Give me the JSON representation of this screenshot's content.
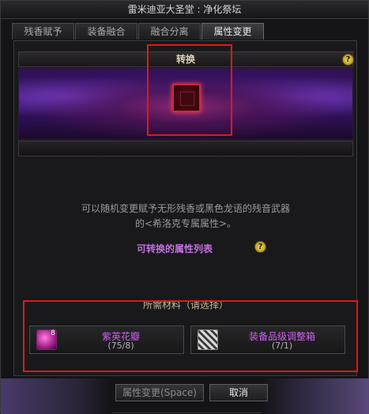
{
  "window": {
    "title": "雷米迪亚大圣堂 : 净化祭坛"
  },
  "tabs": [
    {
      "label": "残香赋予"
    },
    {
      "label": "装备融合"
    },
    {
      "label": "融合分离"
    },
    {
      "label": "属性变更",
      "active": true
    }
  ],
  "section": {
    "title": "转换",
    "help": "?"
  },
  "description": {
    "line1": "可以随机变更赋予无形残香或黑色龙语的残音武器",
    "line2": "的<希洛克专属属性>。"
  },
  "attribute_list": {
    "title": "可转换的属性列表",
    "help": "?"
  },
  "materials": {
    "header": "所需材料（请选择）",
    "items": [
      {
        "name": "紫英花瓣",
        "count": "(75/8)",
        "icon": "purple-petal-icon",
        "badge": "8"
      },
      {
        "name": "装备品级调整箱",
        "count": "(7/1)",
        "icon": "equipment-grade-box-icon"
      }
    ]
  },
  "buttons": {
    "convert": "属性变更(Space)",
    "cancel": "取消"
  },
  "colors": {
    "highlight_box": "#e01818",
    "item_name": "#d060f0",
    "list_title": "#c070e0"
  }
}
